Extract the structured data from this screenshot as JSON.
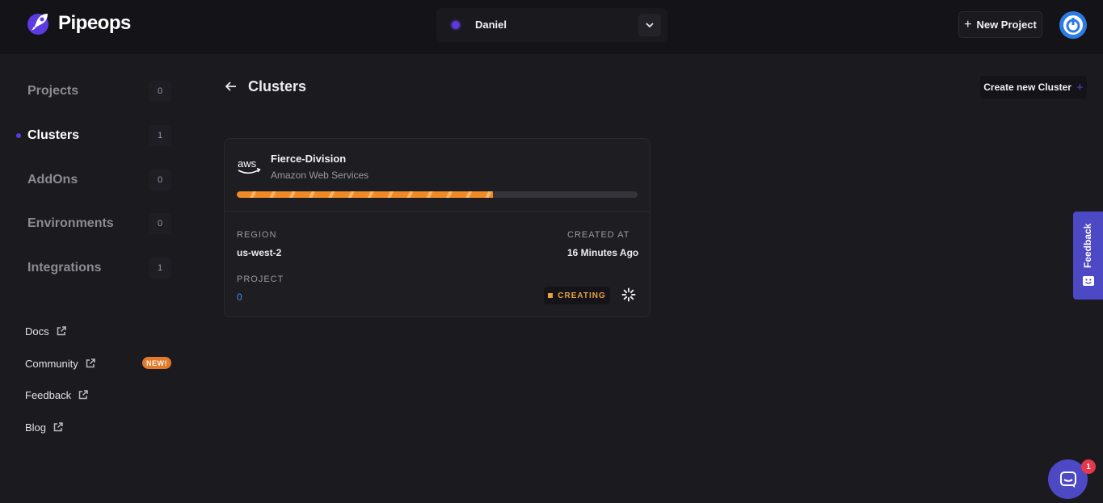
{
  "header": {
    "brand": "Pipeops",
    "workspace": "Daniel",
    "new_project_label": "New Project"
  },
  "sidebar": {
    "nav": [
      {
        "label": "Projects",
        "count": "0",
        "active": false
      },
      {
        "label": "Clusters",
        "count": "1",
        "active": true
      },
      {
        "label": "AddOns",
        "count": "0",
        "active": false
      },
      {
        "label": "Environments",
        "count": "0",
        "active": false
      },
      {
        "label": "Integrations",
        "count": "1",
        "active": false
      }
    ],
    "links": [
      {
        "label": "Docs"
      },
      {
        "label": "Community",
        "badge": "NEW!"
      },
      {
        "label": "Feedback"
      },
      {
        "label": "Blog"
      }
    ]
  },
  "main": {
    "title": "Clusters",
    "create_label": "Create new Cluster"
  },
  "cluster": {
    "name": "Fierce-Division",
    "provider": "Amazon Web Services",
    "provider_logo": "aws",
    "progress": 0.64,
    "region_label": "REGION",
    "region": "us-west-2",
    "created_label": "CREATED AT",
    "created": "16 Minutes Ago",
    "project_label": "PROJECT",
    "project": "0",
    "status": "CREATING"
  },
  "feedback_tab": {
    "label": "Feedback"
  },
  "chat": {
    "unread": "1"
  },
  "colors": {
    "accent": "#5b3be0",
    "progress": "#ef8a26",
    "status": "#e7a046",
    "link": "#3f8ef0",
    "feedback": "#4d48c4"
  },
  "icons": [
    "rocket-logo-icon",
    "chevron-down-icon",
    "plus-icon",
    "power-icon",
    "arrow-left-icon",
    "external-link-icon",
    "aws-logo-icon",
    "spinner-icon",
    "feedback-face-icon",
    "chat-icon"
  ]
}
